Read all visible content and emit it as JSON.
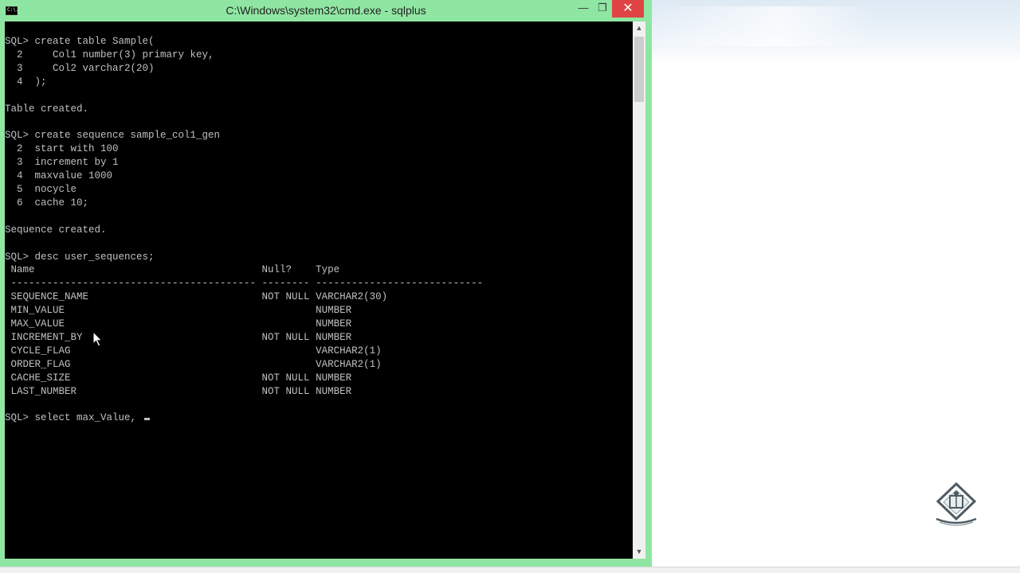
{
  "window": {
    "title": "C:\\Windows\\system32\\cmd.exe - sqlplus",
    "icon_label": "C:\\.",
    "controls": {
      "minimize": "—",
      "maximize": "❐",
      "close": "✕"
    }
  },
  "console": {
    "lines": [
      "SQL> create table Sample(",
      "  2     Col1 number(3) primary key,",
      "  3     Col2 varchar2(20)",
      "  4  );",
      "",
      "Table created.",
      "",
      "SQL> create sequence sample_col1_gen",
      "  2  start with 100",
      "  3  increment by 1",
      "  4  maxvalue 1000",
      "  5  nocycle",
      "  6  cache 10;",
      "",
      "Sequence created.",
      "",
      "SQL> desc user_sequences;",
      " Name                                      Null?    Type",
      " ----------------------------------------- -------- ----------------------------",
      " SEQUENCE_NAME                             NOT NULL VARCHAR2(30)",
      " MIN_VALUE                                          NUMBER",
      " MAX_VALUE                                          NUMBER",
      " INCREMENT_BY                              NOT NULL NUMBER",
      " CYCLE_FLAG                                         VARCHAR2(1)",
      " ORDER_FLAG                                         VARCHAR2(1)",
      " CACHE_SIZE                                NOT NULL NUMBER",
      " LAST_NUMBER                               NOT NULL NUMBER",
      ""
    ],
    "input_line": "SQL> select max_Value, "
  },
  "scrollbar": {
    "up": "▲",
    "down": "▼"
  },
  "colors": {
    "titlebar": "#8fe6a2",
    "console_bg": "#000000",
    "console_fg": "#c0c0c0",
    "close": "#e04343"
  }
}
